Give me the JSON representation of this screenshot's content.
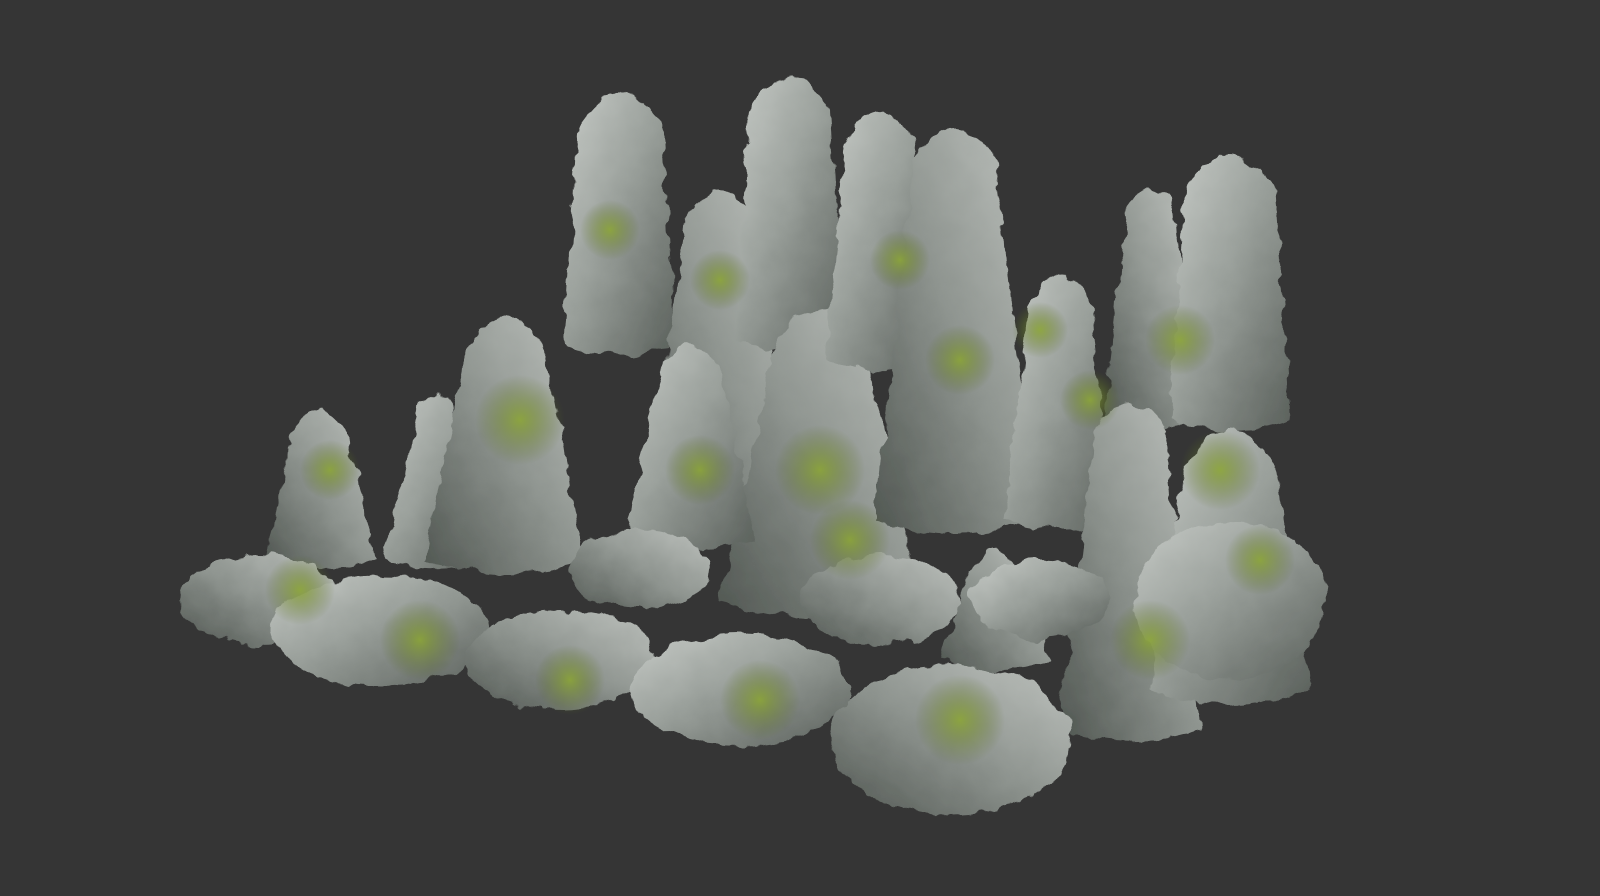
{
  "scene": {
    "subject": "stalagmite-rock-cluster",
    "colors": {
      "background": "#353535",
      "rock_light": "#b9bdb9",
      "rock_mid": "#8f9590",
      "rock_dark": "#4f5550",
      "moss": "#7f9a2e",
      "moss_dark": "#55691f"
    }
  }
}
